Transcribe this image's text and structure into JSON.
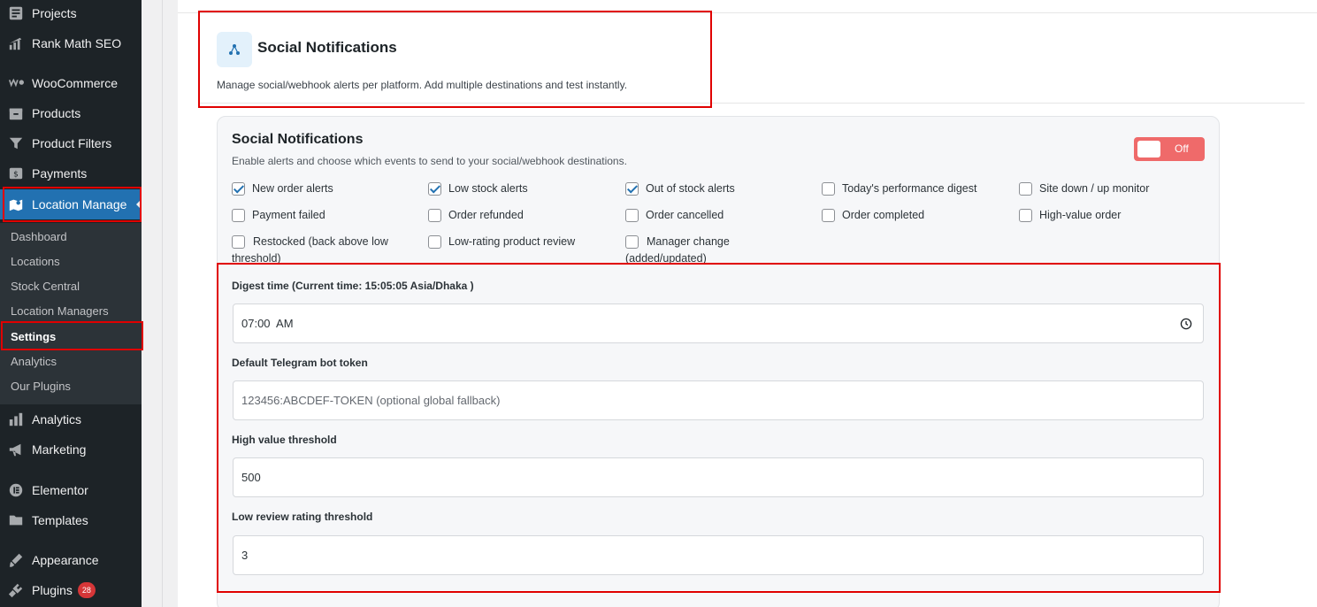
{
  "sidebar": {
    "items": [
      {
        "label": "Projects",
        "icon": "projects-icon"
      },
      {
        "label": "Rank Math SEO",
        "icon": "rank-math-icon"
      },
      {
        "label": "WooCommerce",
        "icon": "woocommerce-icon"
      },
      {
        "label": "Products",
        "icon": "products-icon"
      },
      {
        "label": "Product Filters",
        "icon": "filter-icon"
      },
      {
        "label": "Payments",
        "icon": "payments-icon"
      },
      {
        "label": "Location Manage",
        "icon": "location-icon"
      },
      {
        "label": "Analytics",
        "icon": "analytics-icon"
      },
      {
        "label": "Marketing",
        "icon": "megaphone-icon"
      },
      {
        "label": "Elementor",
        "icon": "elementor-icon"
      },
      {
        "label": "Templates",
        "icon": "folder-icon"
      },
      {
        "label": "Appearance",
        "icon": "brush-icon"
      },
      {
        "label": "Plugins",
        "icon": "plugin-icon",
        "badge": "28"
      }
    ],
    "submenu": [
      {
        "label": "Dashboard"
      },
      {
        "label": "Locations"
      },
      {
        "label": "Stock Central"
      },
      {
        "label": "Location Managers"
      },
      {
        "label": "Settings"
      },
      {
        "label": "Analytics"
      },
      {
        "label": "Our Plugins"
      }
    ]
  },
  "header": {
    "title": "Social Notifications",
    "description": "Manage social/webhook alerts per platform. Add multiple destinations and test instantly.",
    "icon": "share-nodes-icon"
  },
  "card": {
    "title": "Social Notifications",
    "description": "Enable alerts and choose which events to send to your social/webhook destinations.",
    "toggle_label": "Off",
    "events": [
      {
        "label": "New order alerts",
        "checked": true
      },
      {
        "label": "Low stock alerts",
        "checked": true
      },
      {
        "label": "Out of stock alerts",
        "checked": true
      },
      {
        "label": "Today's performance digest",
        "checked": false
      },
      {
        "label": "Site down / up monitor",
        "checked": false
      },
      {
        "label": "Payment failed",
        "checked": false
      },
      {
        "label": "Order refunded",
        "checked": false
      },
      {
        "label": "Order cancelled",
        "checked": false
      },
      {
        "label": "Order completed",
        "checked": false
      },
      {
        "label": "High-value order",
        "checked": false
      },
      {
        "label": "Restocked (back above low threshold)",
        "checked": false
      },
      {
        "label": "Low-rating product review",
        "checked": false
      },
      {
        "label": "Manager change (added/updated)",
        "checked": false
      }
    ],
    "fields": {
      "digest_label": "Digest time (Current time: 15:05:05 Asia/Dhaka )",
      "digest_value": "07:00  AM",
      "telegram_label": "Default Telegram bot token",
      "telegram_placeholder": "123456:ABCDEF-TOKEN (optional global fallback)",
      "high_value_label": "High value threshold",
      "high_value_value": "500",
      "low_review_label": "Low review rating threshold",
      "low_review_value": "3"
    }
  },
  "colors": {
    "sidebar_bg": "#1d2327",
    "accent": "#2271b1",
    "toggle_off": "#ef6a6a",
    "highlight": "#e00000"
  }
}
